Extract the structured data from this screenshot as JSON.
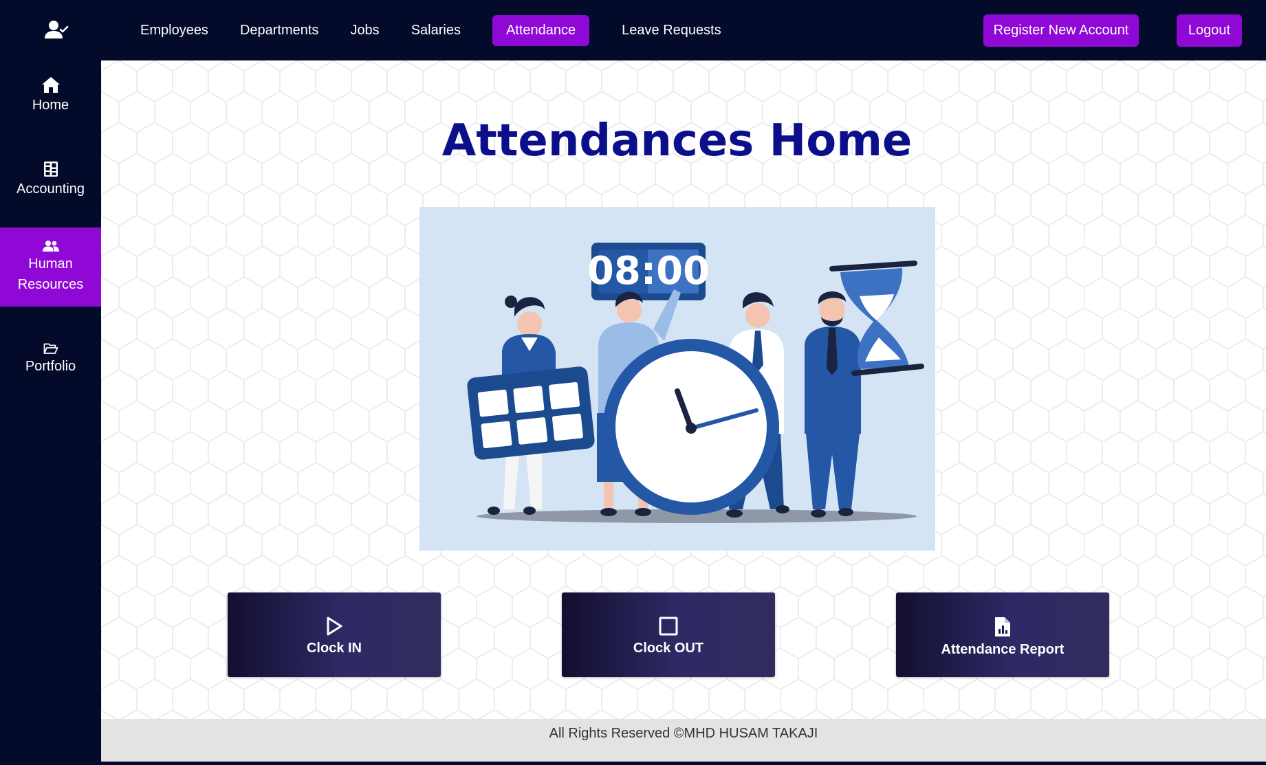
{
  "nav": {
    "items": [
      {
        "label": "Employees"
      },
      {
        "label": "Departments"
      },
      {
        "label": "Jobs"
      },
      {
        "label": "Salaries"
      },
      {
        "label": "Attendance",
        "active": true
      },
      {
        "label": "Leave Requests"
      }
    ],
    "register_label": "Register New Account",
    "logout_label": "Logout",
    "brand_icon": "user-check-icon"
  },
  "sidebar": {
    "items": [
      {
        "label": "Home",
        "icon": "home-icon"
      },
      {
        "label": "Accounting",
        "icon": "calculator-icon"
      },
      {
        "label": "Human Resources",
        "icon": "users-icon",
        "active": true
      },
      {
        "label": "Portfolio",
        "icon": "folder-open-icon"
      }
    ]
  },
  "main": {
    "title": "Attendances Home",
    "hero": {
      "clock_display": "08:00"
    },
    "actions": [
      {
        "label": "Clock IN",
        "icon": "play-icon"
      },
      {
        "label": "Clock OUT",
        "icon": "stop-icon"
      },
      {
        "label": "Attendance Report",
        "icon": "file-chart-icon"
      }
    ]
  },
  "footer": {
    "text": "All Rights Reserved ©MHD HUSAM TAKAJI"
  },
  "colors": {
    "navy": "#030a2a",
    "accent": "#8f08d6",
    "title": "#0c0f8a"
  }
}
